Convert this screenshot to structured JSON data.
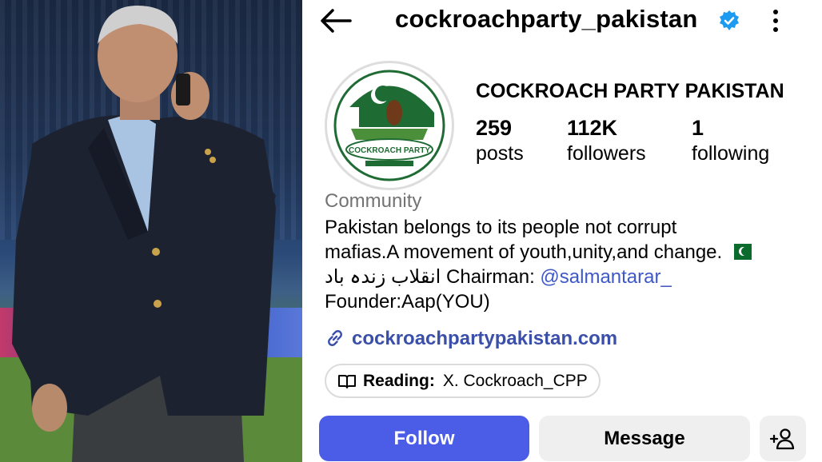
{
  "topbar": {
    "handle": "cockroachparty_pakistan"
  },
  "profile": {
    "display_name": "COCKROACH PARTY PAKISTAN",
    "avatar_logo_text": "COCKROACH PARTY",
    "posts_count": "259",
    "posts_label": "posts",
    "followers_count": "112K",
    "followers_label": "followers",
    "following_count": "1",
    "following_label": "following",
    "category": "Community",
    "bio_line1": "Pakistan belongs to its people not corrupt",
    "bio_line2": "mafias.A movement of youth,unity,and change.",
    "bio_line3_urdu": "انقلاب زندہ باد",
    "bio_line3_label": " Chairman: ",
    "bio_mention": "@salmantarar_",
    "bio_line4": "Founder:Aap(YOU)",
    "website": "cockroachpartypakistan.com",
    "threads_reading_label": "Reading:",
    "threads_reading_value": "X. Cockroach_CPP"
  },
  "actions": {
    "follow_label": "Follow",
    "message_label": "Message"
  },
  "colors": {
    "follow_blue": "#4b5de6",
    "link_blue": "#3a4fa9",
    "verified_blue": "#1d9bf0",
    "muted": "#737373"
  },
  "icons": [
    "back-arrow-icon",
    "verified-badge-icon",
    "more-options-icon",
    "link-icon",
    "book-icon",
    "add-user-icon"
  ]
}
